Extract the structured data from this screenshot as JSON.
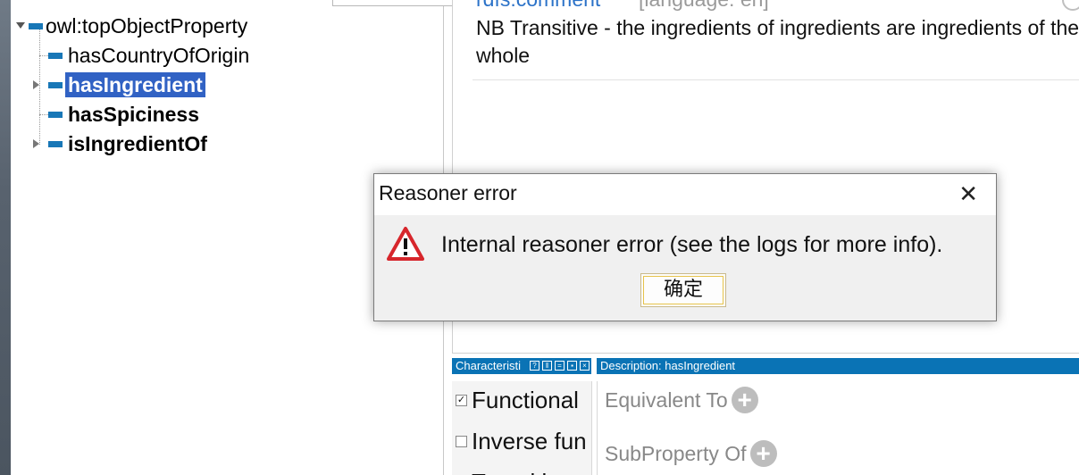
{
  "tree": {
    "root": "owl:topObjectProperty",
    "items": [
      {
        "label": "hasCountryOfOrigin",
        "bold": false,
        "selected": false,
        "expandable": false
      },
      {
        "label": "hasIngredient",
        "bold": true,
        "selected": true,
        "expandable": true
      },
      {
        "label": "hasSpiciness",
        "bold": true,
        "selected": false,
        "expandable": false
      },
      {
        "label": "isIngredientOf",
        "bold": true,
        "selected": false,
        "expandable": true
      }
    ]
  },
  "annotation": {
    "property": "rdfs:comment",
    "lang": "[language: en]",
    "text": "NB Transitive - the ingredients of ingredients are ingredients of the whole"
  },
  "characteristics": {
    "header": "Characteristi",
    "items": [
      {
        "label": "Functional",
        "checked": true
      },
      {
        "label": "Inverse fun",
        "checked": false
      },
      {
        "label": "Transitive",
        "checked": false
      }
    ]
  },
  "description": {
    "header": "Description: hasIngredient",
    "sections": [
      "Equivalent To",
      "SubProperty Of"
    ]
  },
  "dialog": {
    "title": "Reasoner error",
    "message": "Internal reasoner error (see the logs for more info).",
    "ok_label": "确定",
    "close_glyph": "✕"
  },
  "colors": {
    "accent": "#0a73b5",
    "selection": "#3162c4",
    "property_icon": "#1877b7",
    "warning_red": "#d7262c"
  }
}
